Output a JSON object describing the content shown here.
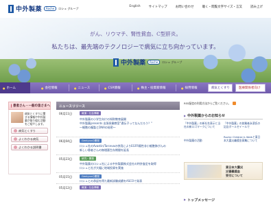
{
  "header": {
    "company_name": "中外製薬",
    "roche_label": "Roche",
    "group_label": "ロシュ グループ",
    "links": [
      "English",
      "サイトマップ",
      "お問い合わせ",
      "聴く・閲覧文字サイズ・言又",
      "読み上げ"
    ]
  },
  "hero": {
    "line1": "がん、リウマチ、腎性貧血、C型肝炎。",
    "line2": "私たちは、最先端のテクノロジーで病気に立ち向かっています。",
    "logo_name": "中外製薬",
    "logo_roche": "Roche",
    "logo_group": "ロシュ グループ"
  },
  "nav": {
    "items": [
      "ホーム",
      "会社情報",
      "ニュース",
      "CSR情報",
      "株主・投資家情報",
      "採用情報"
    ],
    "button_disease": "病気とくすり",
    "button_medical": "医療関係者向け"
  },
  "sidebar_left": {
    "title": "患者さん・一般の皆さまへ",
    "description": "病気とくすりに関する情報や中外製薬が取り組む活動をご紹介します。",
    "buttons": [
      "病気とくすり",
      "よくわかる病気",
      "よくわかる説明書"
    ]
  },
  "news": {
    "heading": "ニュースリリース",
    "entries": [
      {
        "date": "06月11日",
        "tag": "報道・社会情報",
        "lines": [
          "中外製薬の小学生向けの知財教育展開",
          "中外製薬presents 出張授業教室\"遺伝子ってなんだろう？\"",
          "～細胞の複製とDNAの秘密～"
        ]
      },
      {
        "date": "06月04日",
        "tag": "Gentyuxの開発",
        "lines": [
          "ロシュ社のAvastin/Tarcevaの併用によりEGFR陽性非小細胞肺がんの",
          "新しい患者さんの無増悪生存期間を延長"
        ]
      },
      {
        "date": "05月23日",
        "tag": "研究・開発",
        "lines": [
          "中外製薬のロシュ社による中外製薬株式会社の特許査定を取得",
          "ロシュと社が大幅に地域投資を実施"
        ]
      },
      {
        "date": "05月15日",
        "tag": "Gentyuxの開発",
        "lines": [
          "ロシュとの承認を得た最新試験成績をASCOで発表"
        ]
      },
      {
        "date": "05月12日",
        "tag": "報道・社会情報",
        "lines": [
          "ロシュとの「中外」新規事業のお知らせ"
        ]
      }
    ]
  },
  "sidebar_right": {
    "rss_text": "RSS配信の利用方法からご覧ください。",
    "section_title": "中外製薬からのお知らせ",
    "left_links": [
      "「中外製薬」の新社名表示と当社の新ロゴマークについて",
      "中外製薬の活動"
    ],
    "right_links": [
      "「中外製薬」の創業者永濱氏の記念ボールセイールで",
      "Roche Children's Walkと東日本大震災義援金募集について"
    ],
    "banner_line1": "東日本大震災",
    "banner_line2": "災害義援金",
    "banner_line3": "受付について",
    "bottom_title": "トップメッセージ"
  },
  "colors": {
    "nav_purple": "#6f5aab",
    "nav_home": "#4e3a8c",
    "brand_blue": "#1f5aa6",
    "link_blue": "#2a4e8c",
    "news_bar": "#7c768a"
  }
}
